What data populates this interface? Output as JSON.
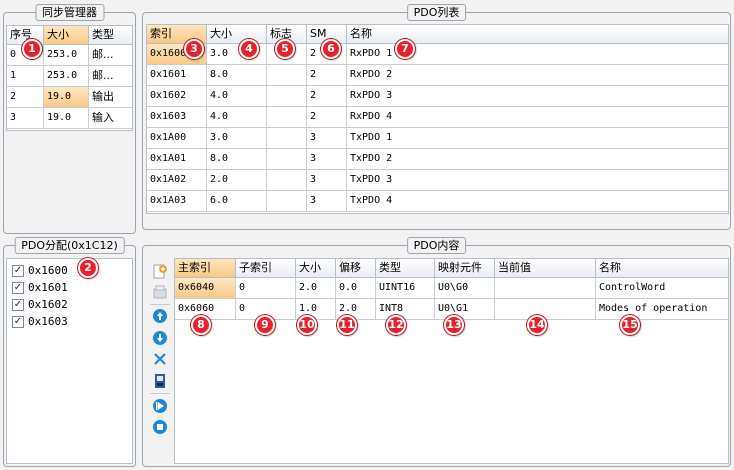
{
  "sync_manager": {
    "title": "同步管理器",
    "columns": [
      "序号",
      "大小",
      "类型"
    ],
    "rows": [
      [
        "0",
        "253.0",
        "邮..."
      ],
      [
        "1",
        "253.0",
        "邮..."
      ],
      [
        "2",
        "19.0",
        "输出"
      ],
      [
        "3",
        "19.0",
        "输入"
      ]
    ]
  },
  "pdo_list": {
    "title": "PDO列表",
    "columns": [
      "索引",
      "大小",
      "标志",
      "SM",
      "名称"
    ],
    "rows": [
      [
        "0x1600",
        "3.0",
        "",
        "2",
        "RxPDO 1"
      ],
      [
        "0x1601",
        "8.0",
        "",
        "2",
        "RxPDO 2"
      ],
      [
        "0x1602",
        "4.0",
        "",
        "2",
        "RxPDO 3"
      ],
      [
        "0x1603",
        "4.0",
        "",
        "2",
        "RxPDO 4"
      ],
      [
        "0x1A00",
        "3.0",
        "",
        "3",
        "TxPDO 1"
      ],
      [
        "0x1A01",
        "8.0",
        "",
        "3",
        "TxPDO 2"
      ],
      [
        "0x1A02",
        "2.0",
        "",
        "3",
        "TxPDO 3"
      ],
      [
        "0x1A03",
        "6.0",
        "",
        "3",
        "TxPDO 4"
      ]
    ]
  },
  "pdo_assign": {
    "title": "PDO分配(0x1C12)",
    "items": [
      "0x1600",
      "0x1601",
      "0x1602",
      "0x1603"
    ],
    "checked": [
      true,
      true,
      true,
      true
    ]
  },
  "pdo_content": {
    "title": "PDO内容",
    "columns": [
      "主索引",
      "子索引",
      "大小",
      "偏移",
      "类型",
      "映射元件",
      "当前值",
      "名称"
    ],
    "rows": [
      [
        "0x6040",
        "0",
        "2.0",
        "0.0",
        "UINT16",
        "U0\\G0",
        "",
        "ControlWord"
      ],
      [
        "0x6060",
        "0",
        "1.0",
        "2.0",
        "INT8",
        "U0\\G1",
        "",
        "Modes of operation"
      ]
    ]
  },
  "toolbar_icons": [
    "add-icon",
    "copy-icon",
    "move-up-icon",
    "move-down-icon",
    "delete-icon",
    "save-icon",
    "play-icon",
    "stop-icon"
  ],
  "badges": [
    "1",
    "2",
    "3",
    "4",
    "5",
    "6",
    "7",
    "8",
    "9",
    "10",
    "11",
    "12",
    "13",
    "14",
    "15"
  ],
  "colors": {
    "selected_header": "#f8c884",
    "badge": "#e8202a",
    "toolbar_blue": "#1e88d8"
  }
}
